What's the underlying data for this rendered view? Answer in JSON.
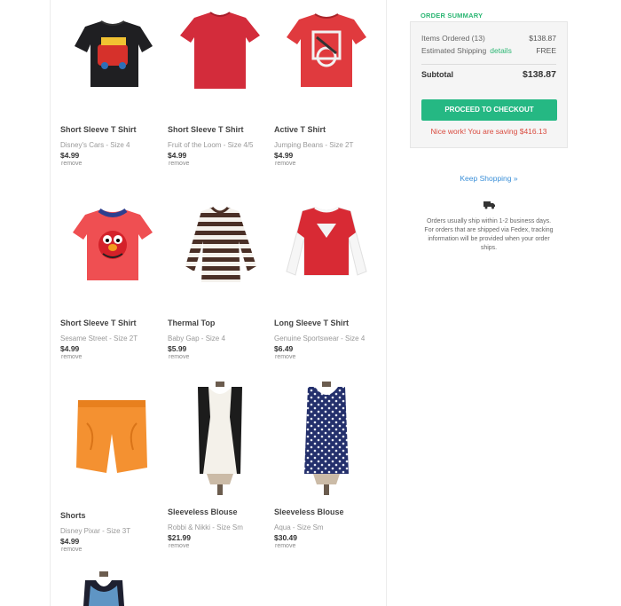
{
  "products": [
    {
      "name": "Short Sleeve T Shirt",
      "meta": "Disney's Cars - Size 4",
      "price": "$4.99",
      "remove": "remove",
      "image": "black-cars-tshirt"
    },
    {
      "name": "Short Sleeve T Shirt",
      "meta": "Fruit of the Loom - Size 4/5",
      "price": "$4.99",
      "remove": "remove",
      "image": "red-plain-tshirt"
    },
    {
      "name": "Active T Shirt",
      "meta": "Jumping Beans - Size 2T",
      "price": "$4.99",
      "remove": "remove",
      "image": "red-graphic-tshirt"
    },
    {
      "name": "Short Sleeve T Shirt",
      "meta": "Sesame Street - Size 2T",
      "price": "$4.99",
      "remove": "remove",
      "image": "red-elmo-tshirt"
    },
    {
      "name": "Thermal Top",
      "meta": "Baby Gap - Size 4",
      "price": "$5.99",
      "remove": "remove",
      "image": "striped-thermal-top"
    },
    {
      "name": "Long Sleeve T Shirt",
      "meta": "Genuine Sportswear - Size 4",
      "price": "$6.49",
      "remove": "remove",
      "image": "red-longsleeve-tshirt"
    },
    {
      "name": "Shorts",
      "meta": "Disney Pixar - Size 3T",
      "price": "$4.99",
      "remove": "remove",
      "image": "orange-shorts"
    },
    {
      "name": "Sleeveless Blouse",
      "meta": "Robbi & Nikki - Size Sm",
      "price": "$21.99",
      "remove": "remove",
      "image": "black-white-blouse"
    },
    {
      "name": "Sleeveless Blouse",
      "meta": "Aqua - Size Sm",
      "price": "$30.49",
      "remove": "remove",
      "image": "navy-print-blouse"
    }
  ],
  "summary": {
    "title": "ORDER SUMMARY",
    "items_label": "Items Ordered (13)",
    "items_value": "$138.87",
    "shipping_label": "Estimated Shipping",
    "shipping_link": "details",
    "shipping_value": "FREE",
    "subtotal_label": "Subtotal",
    "subtotal_value": "$138.87",
    "checkout_label": "PROCEED TO CHECKOUT",
    "savings_text": "Nice work! You are saving $416.13"
  },
  "keep_shopping": "Keep Shopping »",
  "shipping_note": "Orders usually ship within 1-2 business days. For orders that are shipped via Fedex, tracking information will be provided when your order ships.",
  "colors": {
    "accent": "#25b883",
    "link": "#3a8fd8",
    "savings": "#d94b3f"
  }
}
